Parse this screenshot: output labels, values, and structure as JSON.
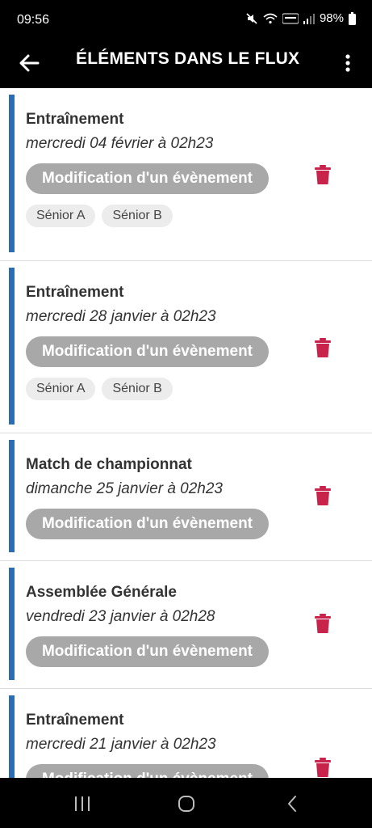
{
  "status_bar": {
    "time": "09:56",
    "battery": "98%"
  },
  "app_bar": {
    "title": "ÉLÉMENTS DANS LE FLUX"
  },
  "feed": {
    "items": [
      {
        "title": "Entraînement",
        "date": "mercredi 04 février à 02h23",
        "badge": "Modification d'un évènement",
        "tags": [
          "Sénior A",
          "Sénior B"
        ]
      },
      {
        "title": "Entraînement",
        "date": "mercredi 28 janvier à 02h23",
        "badge": "Modification d'un évènement",
        "tags": [
          "Sénior A",
          "Sénior B"
        ]
      },
      {
        "title": "Match de championnat",
        "date": "dimanche 25 janvier à 02h23",
        "badge": "Modification d'un évènement",
        "tags": []
      },
      {
        "title": "Assemblée Générale",
        "date": "vendredi 23 janvier à 02h28",
        "badge": "Modification d'un évènement",
        "tags": []
      },
      {
        "title": "Entraînement",
        "date": "mercredi 21 janvier à 02h23",
        "badge": "Modification d'un évènement",
        "tags": []
      }
    ]
  },
  "colors": {
    "accent": "#2a6db5",
    "delete": "#c8234b",
    "badge": "#a8a8a8"
  },
  "icons": {
    "back": "arrow-left-icon",
    "menu": "more-vert-icon",
    "delete": "trash-icon"
  }
}
